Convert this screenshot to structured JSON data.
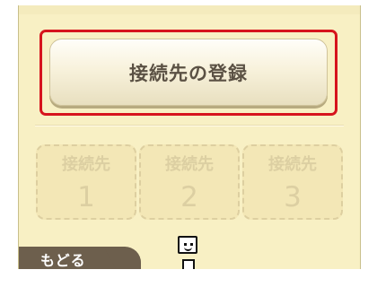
{
  "main": {
    "register_button_label": "接続先の登録"
  },
  "connections": [
    {
      "label": "接続先",
      "number": "1"
    },
    {
      "label": "接続先",
      "number": "2"
    },
    {
      "label": "接続先",
      "number": "3"
    }
  ],
  "footer": {
    "back_label": "もどる",
    "mascot_icon": "mascot-icon"
  },
  "colors": {
    "screen_background": "#f8f0c4",
    "selection_border": "#d6141d",
    "primary_text": "#5b5144",
    "disabled_text": "#dccfa2",
    "back_button": "#6d5f4d"
  }
}
